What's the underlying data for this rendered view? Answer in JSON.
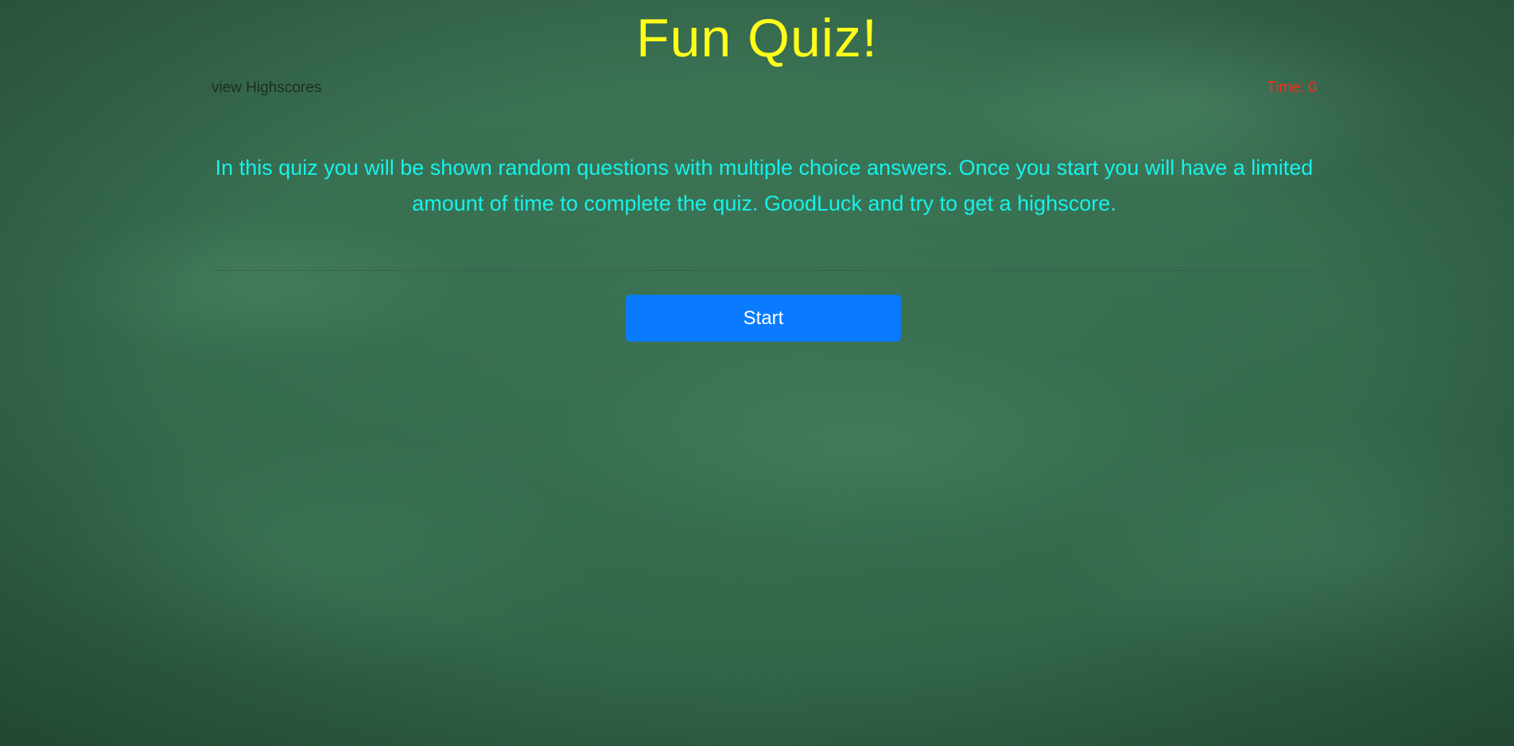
{
  "header": {
    "title": "Fun Quiz!",
    "highscores_link": "view Highscores",
    "timer": "Time: 0"
  },
  "intro": {
    "text": "In this quiz you will be shown random questions with multiple choice answers. Once you start you will have a limited amount of time to complete the quiz. GoodLuck and try to get a highscore."
  },
  "actions": {
    "start_label": "Start"
  },
  "colors": {
    "title": "#ffff1a",
    "intro_text": "#16f2ea",
    "timer": "#ff2a1a",
    "start_button": "#0a7bff",
    "background": "#376b4f"
  }
}
